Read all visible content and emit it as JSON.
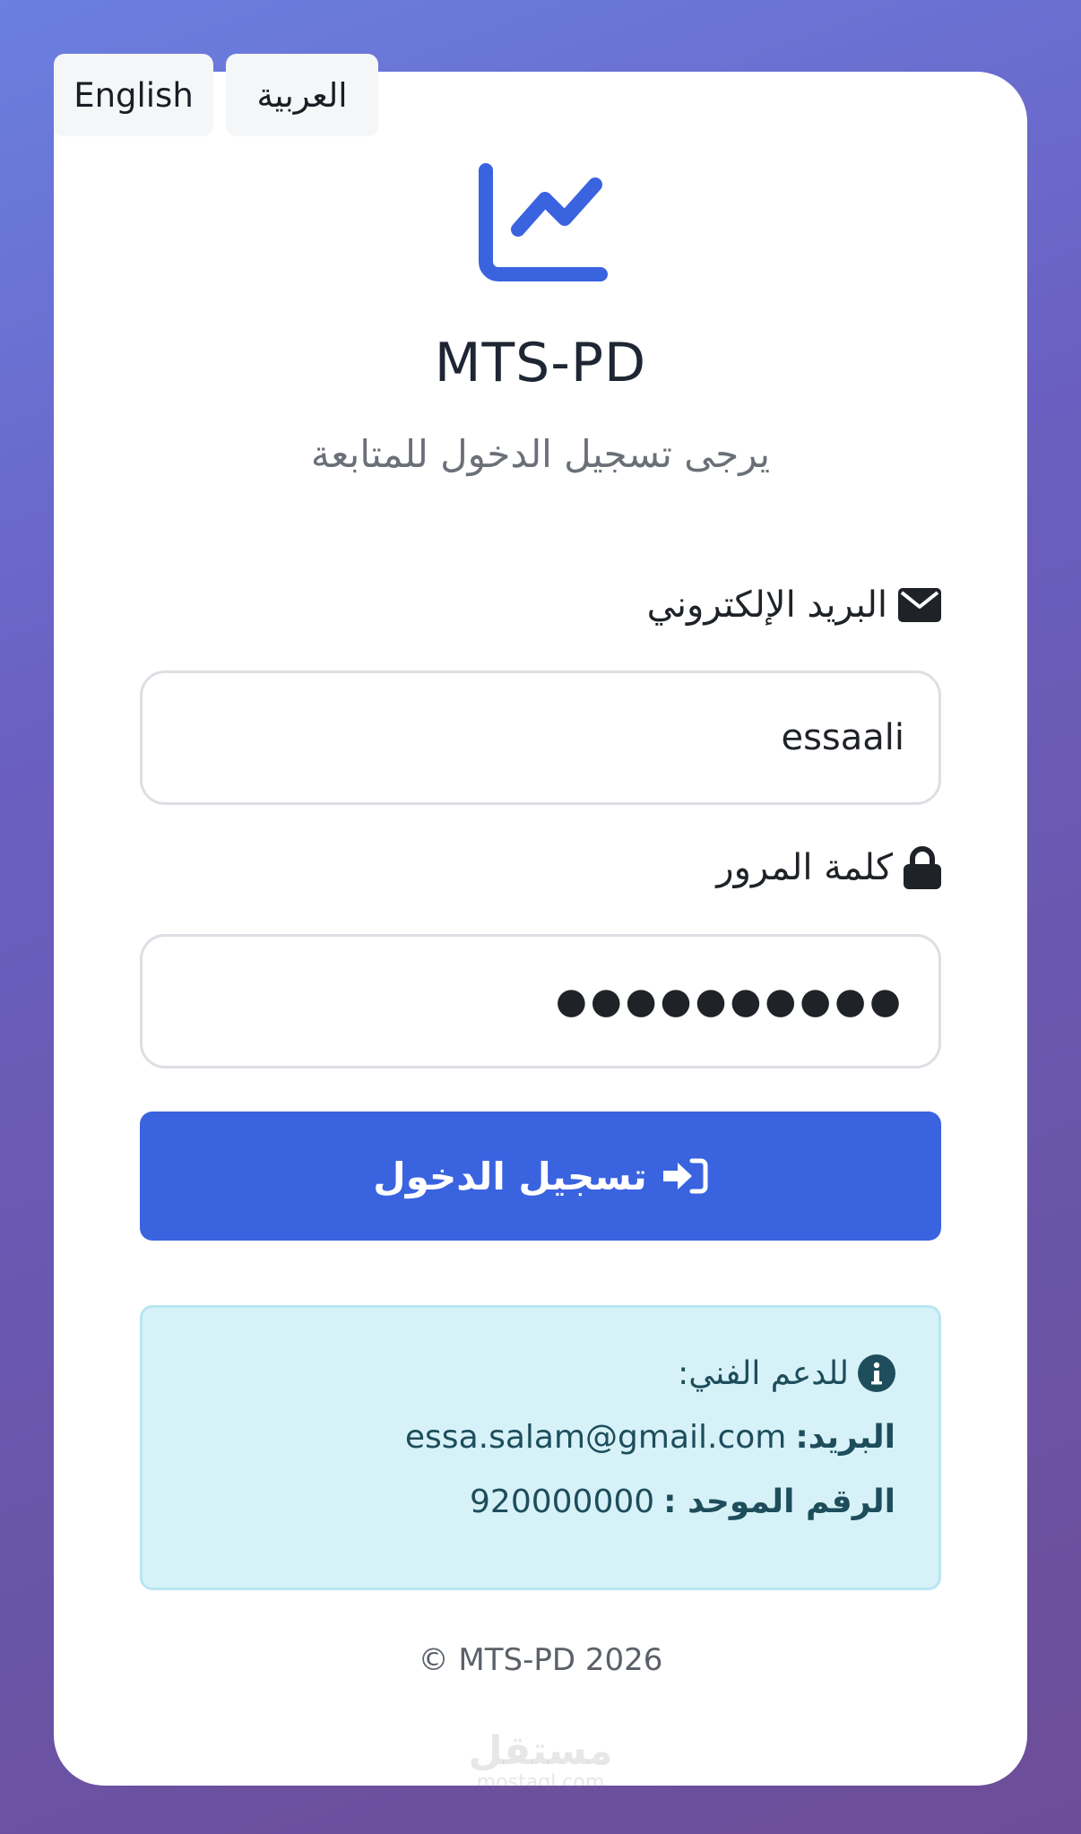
{
  "language_switcher": {
    "english_label": "English",
    "arabic_label": "العربية"
  },
  "header": {
    "logo_icon": "chart-line-icon",
    "title": "MTS-PD",
    "subtitle": "يرجى تسجيل الدخول للمتابعة"
  },
  "form": {
    "email_label": "البريد الإلكتروني",
    "email_icon": "envelope-icon",
    "email_value": "essaali",
    "password_label": "كلمة المرور",
    "password_icon": "lock-icon",
    "password_value": "●●●●●●●●●●",
    "submit_label": "تسجيل الدخول",
    "submit_icon": "sign-in-icon"
  },
  "support": {
    "icon": "info-circle-icon",
    "title": "للدعم الفني:",
    "email_label": "البريد:",
    "email_value": "essa.salam@gmail.com",
    "phone_label": "الرقم الموحد :",
    "phone_value": "920000000"
  },
  "footer": {
    "copyright": "© MTS-PD 2026"
  },
  "watermark": {
    "arabic": "مستقل",
    "latin": "mostaql.com"
  },
  "colors": {
    "primary": "#3a63e0",
    "info_bg": "#d6f2f8",
    "info_text": "#1e4d5c"
  }
}
